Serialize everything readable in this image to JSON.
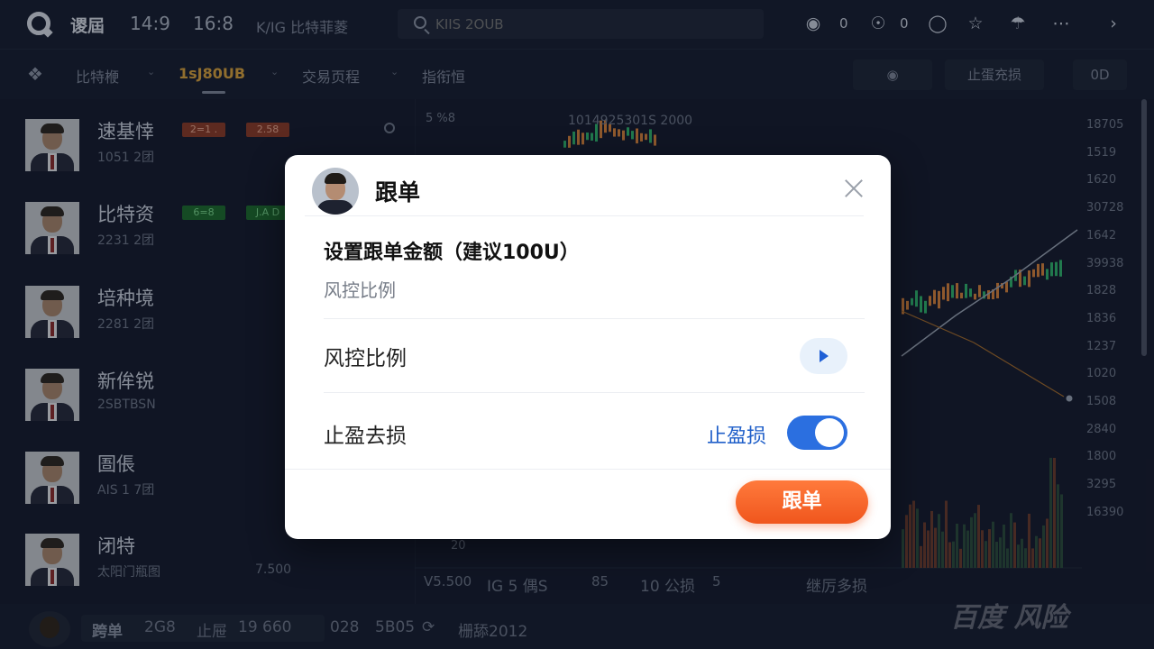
{
  "topbar": {
    "app_name": "谡屆",
    "time_1": "14:9",
    "time_2": "16:8",
    "pair": "K/IG 比特菲菱",
    "search_placeholder": "KIIS 2OUB",
    "notifications_count": "0",
    "coins_count": "0",
    "icons": [
      "logo-icon",
      "robot-icon",
      "coin-icon",
      "chart-icon",
      "star-icon",
      "umbrella-icon",
      "more-icon",
      "chevron-right-icon"
    ]
  },
  "subbar": {
    "items": [
      {
        "label": "比特楩"
      },
      {
        "label": "1sJ80UB"
      },
      {
        "label": "交易页程"
      },
      {
        "label": "指衔恒"
      }
    ],
    "stop_label": "止蛋充损",
    "right_label": "0D"
  },
  "traders": [
    {
      "name": "速基悻",
      "sub": "1051 2团",
      "tag1": "2=1 .",
      "tag2": "2.58",
      "tag_colors": [
        "red",
        "red"
      ],
      "value": ""
    },
    {
      "name": "比特资",
      "sub": "2231 2团",
      "tag1": "6=8",
      "tag2": "J.A D",
      "tag_colors": [
        "green",
        "green"
      ],
      "value": ""
    },
    {
      "name": "培种境",
      "sub": "2281 2团",
      "tag1": "",
      "tag2": "",
      "tag_colors": [],
      "value": ""
    },
    {
      "name": "新侔锐",
      "sub": "2SBTBSN",
      "tag1": "",
      "tag2": "",
      "tag_colors": [],
      "value": ""
    },
    {
      "name": "圄倀",
      "sub": "AIS 1 7团",
      "tag1": "",
      "tag2": "",
      "tag_colors": [],
      "value": ""
    },
    {
      "name": "闭特",
      "sub": "太阳门瓶图",
      "tag1": "",
      "tag2": "",
      "tag_colors": [],
      "value": "7.500"
    }
  ],
  "chart": {
    "top_label_left": "5 %8",
    "top_label_mid": "1014925301S 2000",
    "axis_right": [
      "18705",
      "1519",
      "1620",
      "30728",
      "1642",
      "39938",
      "1828",
      "1836",
      "1237",
      "1020",
      "1508",
      "2840",
      "1800",
      "3295",
      "16390"
    ],
    "bottom_labels": [
      "V5.500",
      "IG 5 偶S",
      "85",
      "10 公损",
      "5",
      "继厉多损"
    ],
    "bottom_left_value": "20"
  },
  "bottombar": {
    "label": "跨单",
    "value_1": "2G8",
    "stop_label": "止屉",
    "value_2": "19 660",
    "value_3": "028",
    "value_4": "5B05",
    "status": "栅舔2012"
  },
  "dialog": {
    "title": "跟单",
    "amount_title": "设置跟单金额（建议100U）",
    "amount_sub": "风控比例",
    "risk_label": "风控比例",
    "tpsl_label": "止盈去损",
    "toggle_label": "止盈损",
    "toggle_on": true,
    "submit_label": "跟单",
    "accent_color": "#2b6fe0",
    "submit_color": "#f0561d"
  },
  "watermark": "百度 风险"
}
